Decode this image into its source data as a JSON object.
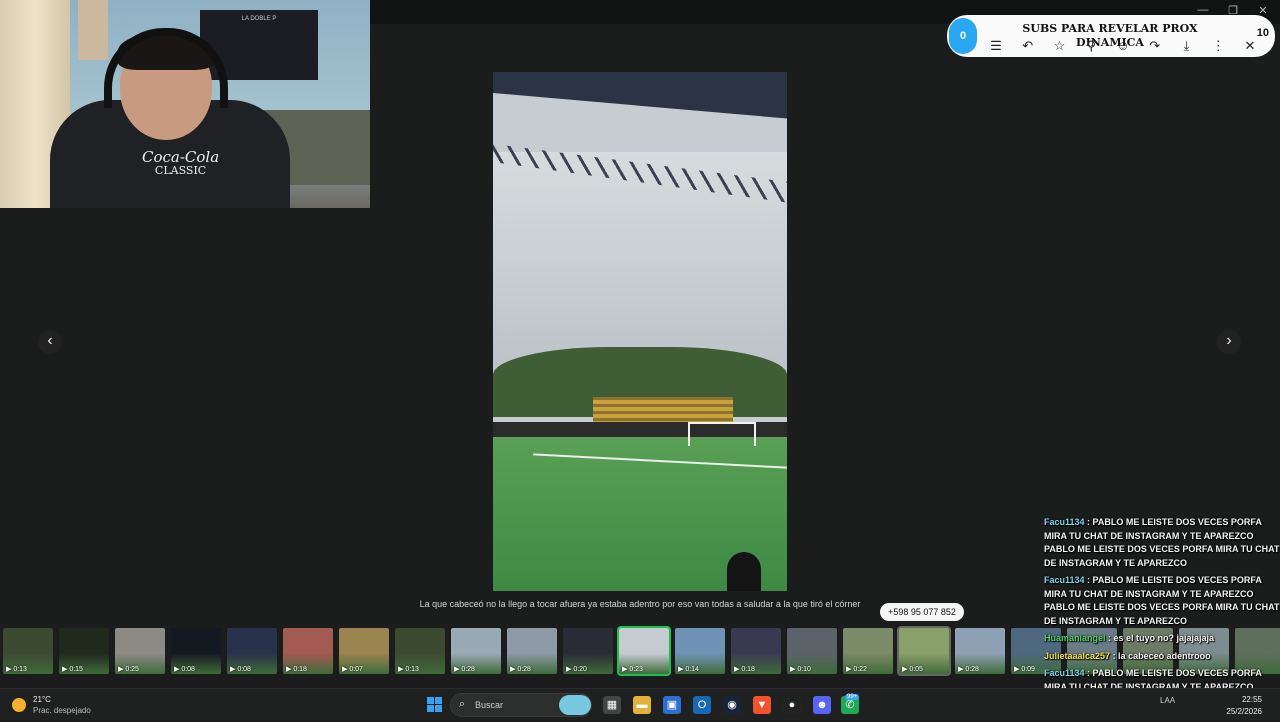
{
  "stream_overlay": {
    "counter_left": "0",
    "counter_right": "10",
    "title_line1": "SUBS PARA REVELAR PROX",
    "title_line2": "DINAMICA",
    "webcam_flag_text": "LA DOBLE P",
    "hoodie_brand": "Coca-Cola",
    "hoodie_sub": "CLASSIC"
  },
  "viewer": {
    "toolbar_icons": [
      "caption-icon",
      "reply-icon",
      "star-icon",
      "pin-icon",
      "emoji-icon",
      "forward-icon",
      "download-icon",
      "more-icon",
      "close-icon"
    ],
    "caption": "La que cabeceó no la llego a tocar afuera ya estaba adentro por eso van todas a saludar a la que tiró el córner",
    "sender_phone": "+598 95 077 852",
    "prev_arrow": "‹",
    "next_arrow": "›"
  },
  "thumbnails": [
    {
      "duration": "0:13",
      "color": "#3c4a32"
    },
    {
      "duration": "0:15",
      "color": "#1f2a1c"
    },
    {
      "duration": "0:25",
      "color": "#8d8a86"
    },
    {
      "duration": "0:08",
      "color": "#141820"
    },
    {
      "duration": "0:08",
      "color": "#28324a"
    },
    {
      "duration": "0:18",
      "color": "#a35a52"
    },
    {
      "duration": "0:07",
      "color": "#9c8450"
    },
    {
      "duration": "0:13",
      "color": "#3c4a32"
    },
    {
      "duration": "0:28",
      "color": "#9aaab4"
    },
    {
      "duration": "0:28",
      "color": "#8e9ba6"
    },
    {
      "duration": "0:20",
      "color": "#2b2b35"
    },
    {
      "duration": "0:23",
      "color": "#c4ccd1"
    },
    {
      "duration": "0:14",
      "color": "#6f93b5"
    },
    {
      "duration": "0:18",
      "color": "#393a52"
    },
    {
      "duration": "0:10",
      "color": "#5b6269"
    },
    {
      "duration": "0:22",
      "color": "#7b8a67"
    },
    {
      "duration": "0:05",
      "color": "#8aa06a"
    },
    {
      "duration": "0:28",
      "color": "#8ea0b3"
    },
    {
      "duration": "0:09",
      "color": "#4e6880"
    },
    {
      "duration": "",
      "color": "#6b7b86"
    },
    {
      "duration": "",
      "color": "#6d7a66"
    },
    {
      "duration": "",
      "color": "#7c8c8f"
    },
    {
      "duration": "",
      "color": "#5d6e5a"
    }
  ],
  "chat": [
    {
      "user": "Facu1134",
      "user_color": "cyan",
      "text": ": PABLO ME LEISTE DOS VECES PORFA MIRA TU CHAT DE INSTAGRAM Y TE APAREZCO PABLO ME LEISTE DOS VECES PORFA MIRA TU CHAT DE INSTAGRAM Y TE APAREZCO"
    },
    {
      "user": "Facu1134",
      "user_color": "cyan",
      "text": ": PABLO ME LEISTE DOS VECES PORFA MIRA TU CHAT DE INSTAGRAM Y TE APAREZCO PABLO ME LEISTE DOS VECES PORFA MIRA TU CHAT DE INSTAGRAM Y TE APAREZCO"
    },
    {
      "user": "Huamaniangel",
      "user_color": "green",
      "text": ": es el tuyo no? jajajajaja"
    },
    {
      "user": "Julietaaalca257",
      "user_color": "yellow",
      "text": ": la cabeceó adentrooo"
    },
    {
      "user": "Facu1134",
      "user_color": "cyan",
      "text": ": PABLO ME LEISTE DOS VECES PORFA MIRA TU CHAT DE INSTAGRAM Y TE APAREZCO"
    }
  ],
  "taskbar": {
    "temperature": "21°C",
    "condition": "Prac. despejado",
    "search_placeholder": "Buscar",
    "notification_badge": "99+",
    "lang": "LAA",
    "time": "22:55",
    "date": "25/2/2026"
  }
}
